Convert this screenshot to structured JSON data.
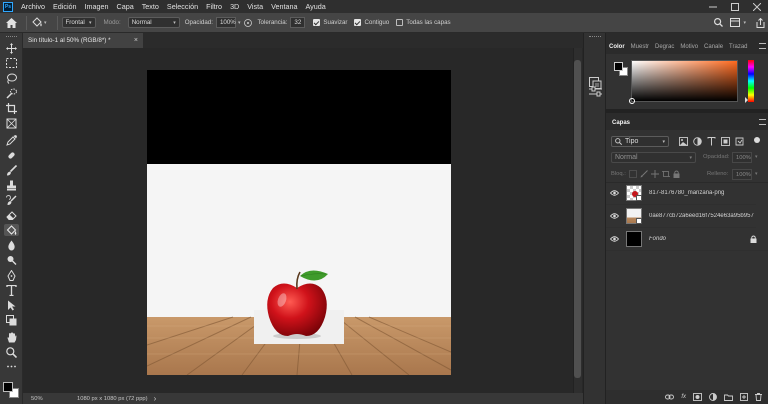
{
  "menubar": {
    "app_logo": "Ps",
    "items": [
      "Archivo",
      "Edición",
      "Imagen",
      "Capa",
      "Texto",
      "Selección",
      "Filtro",
      "3D",
      "Vista",
      "Ventana",
      "Ayuda"
    ]
  },
  "options": {
    "fill_source": "Frontal",
    "mode_label": "Modo:",
    "mode_value": "Normal",
    "opacity_label": "Opacidad:",
    "opacity_value": "100%",
    "tolerance_label": "Tolerancia:",
    "tolerance_value": "32",
    "antialias_label": "Suavizar",
    "antialias_checked": true,
    "contiguous_label": "Contiguo",
    "contiguous_checked": true,
    "all_layers_label": "Todas las capas",
    "all_layers_checked": false
  },
  "document": {
    "tab_title": "Sin título-1 al 50% (RGB/8*) *",
    "close_glyph": "×"
  },
  "status": {
    "zoom": "50%",
    "info": "1080 px x 1080 px (72 ppp)",
    "arrow": "›"
  },
  "panels": {
    "color_tabs": [
      "Color",
      "Muestr",
      "Degrac",
      "Motivo",
      "Canale",
      "Trazad"
    ],
    "layers_tab": "Capas",
    "filter_label": "Tipo",
    "blend_mode": "Normal",
    "opacity_label": "Opacidad:",
    "opacity_value": "100%",
    "lock_label": "Bloq.:",
    "fill_label": "Relleno:",
    "fill_value": "100%",
    "layers": [
      {
        "name": "817-8176780_manzana-png",
        "visible": true,
        "kind": "smart"
      },
      {
        "name": "0ae877cb72a6eed16f7524e63a95b957",
        "visible": true,
        "kind": "smart"
      },
      {
        "name": "Fondo",
        "visible": true,
        "kind": "background",
        "locked": true
      }
    ]
  },
  "colors": {
    "accent": "#31a8ff",
    "foreground": "#000000",
    "background": "#ffffff"
  }
}
